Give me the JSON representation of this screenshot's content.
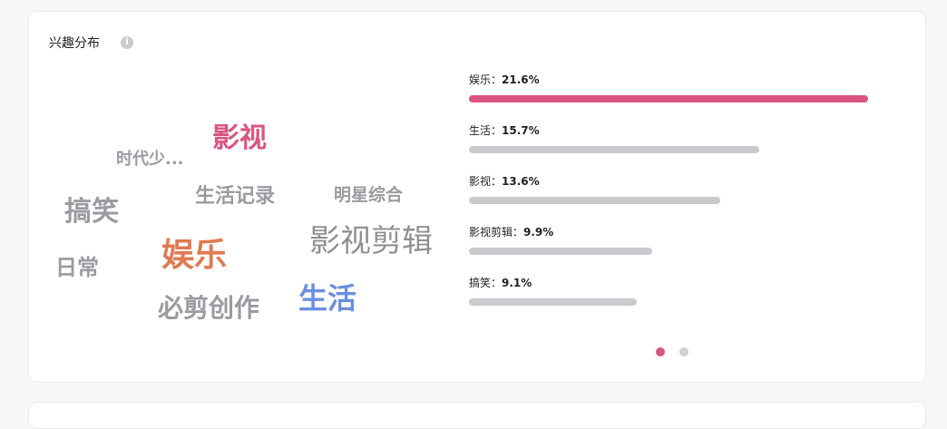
{
  "title": "兴趣分布",
  "info_icon": "info-icon",
  "colors": {
    "accent": "#d9557f",
    "bar_gray": "#c9cacd",
    "word_gray": "#9a9ba0",
    "word_orange": "#e07a52",
    "word_blue": "#6b8fe0",
    "word_pink": "#d9557f"
  },
  "word_cloud": [
    {
      "text": "影视"
    },
    {
      "text": "时代少..."
    },
    {
      "text": "生活记录"
    },
    {
      "text": "明星综合"
    },
    {
      "text": "搞笑"
    },
    {
      "text": "影视剪辑"
    },
    {
      "text": "娱乐"
    },
    {
      "text": "日常"
    },
    {
      "text": "生活"
    },
    {
      "text": "必剪创作"
    }
  ],
  "bars": [
    {
      "label": "娱乐：",
      "value": "21.6%",
      "fraction": 0.216
    },
    {
      "label": "生活：",
      "value": "15.7%",
      "fraction": 0.157
    },
    {
      "label": "影视：",
      "value": "13.6%",
      "fraction": 0.136
    },
    {
      "label": "影视剪辑：",
      "value": "9.9%",
      "fraction": 0.099
    },
    {
      "label": "搞笑：",
      "value": "9.1%",
      "fraction": 0.091
    }
  ],
  "pagination": {
    "pages": 2,
    "current": 1
  }
}
